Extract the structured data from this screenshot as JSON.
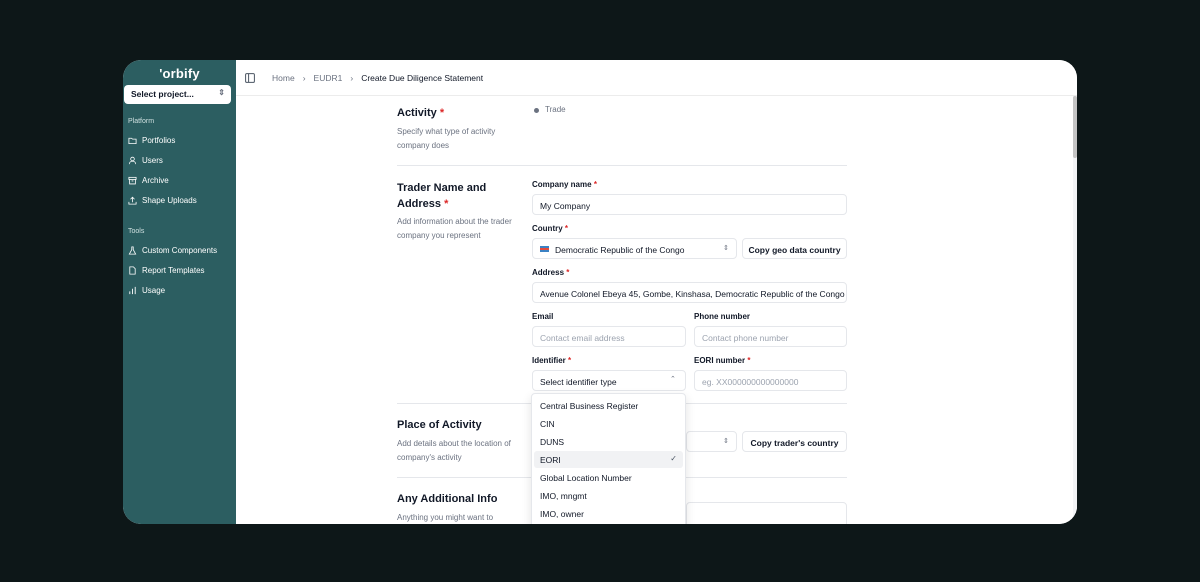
{
  "app": {
    "logo": "'orbify",
    "project_select": "Select project..."
  },
  "sidebar": {
    "sections": [
      {
        "label": "Platform",
        "items": [
          {
            "label": "Portfolios",
            "icon": "folder-icon"
          },
          {
            "label": "Users",
            "icon": "user-icon"
          },
          {
            "label": "Archive",
            "icon": "archive-icon"
          },
          {
            "label": "Shape Uploads",
            "icon": "upload-icon"
          }
        ]
      },
      {
        "label": "Tools",
        "items": [
          {
            "label": "Custom Components",
            "icon": "flask-icon"
          },
          {
            "label": "Report Templates",
            "icon": "document-icon"
          },
          {
            "label": "Usage",
            "icon": "chart-icon"
          }
        ]
      }
    ]
  },
  "breadcrumb": [
    "Home",
    "EUDR1",
    "Create Due Diligence  Statement"
  ],
  "form": {
    "activity": {
      "title": "Activity",
      "required": "*",
      "description": "Specify what type of activity company does",
      "option": "Trade"
    },
    "trader": {
      "title": "Trader Name and Address",
      "required": "*",
      "description": "Add information about the trader company you represent",
      "company_name": {
        "label": "Company name",
        "value": "My Company"
      },
      "country": {
        "label": "Country",
        "value": "Democratic Republic of the Congo",
        "button": "Copy geo data country"
      },
      "address": {
        "label": "Address",
        "value": "Avenue Colonel Ebeya 45, Gombe, Kinshasa, Democratic Republic of the Congo"
      },
      "email": {
        "label": "Email",
        "placeholder": "Contact email address"
      },
      "phone": {
        "label": "Phone number",
        "placeholder": "Contact phone number"
      },
      "identifier": {
        "label": "Identifier",
        "placeholder": "Select identifier type"
      },
      "eori": {
        "label": "EORI number",
        "placeholder": "eg. XX000000000000000"
      }
    },
    "place": {
      "title": "Place of Activity",
      "description": "Add details about the location of company's activity",
      "button": "Copy trader's country"
    },
    "additional": {
      "title": "Any Additional Info",
      "description": "Anything you might want to"
    }
  },
  "identifier_dropdown": {
    "options": [
      "Central Business Register",
      "CIN",
      "DUNS",
      "EORI",
      "Global Location Number",
      "IMO, mngmt",
      "IMO, owner"
    ],
    "selected": "EORI"
  },
  "colors": {
    "sidebar": "#2c5e61",
    "required": "#dc2626",
    "background": "#0d1718"
  }
}
